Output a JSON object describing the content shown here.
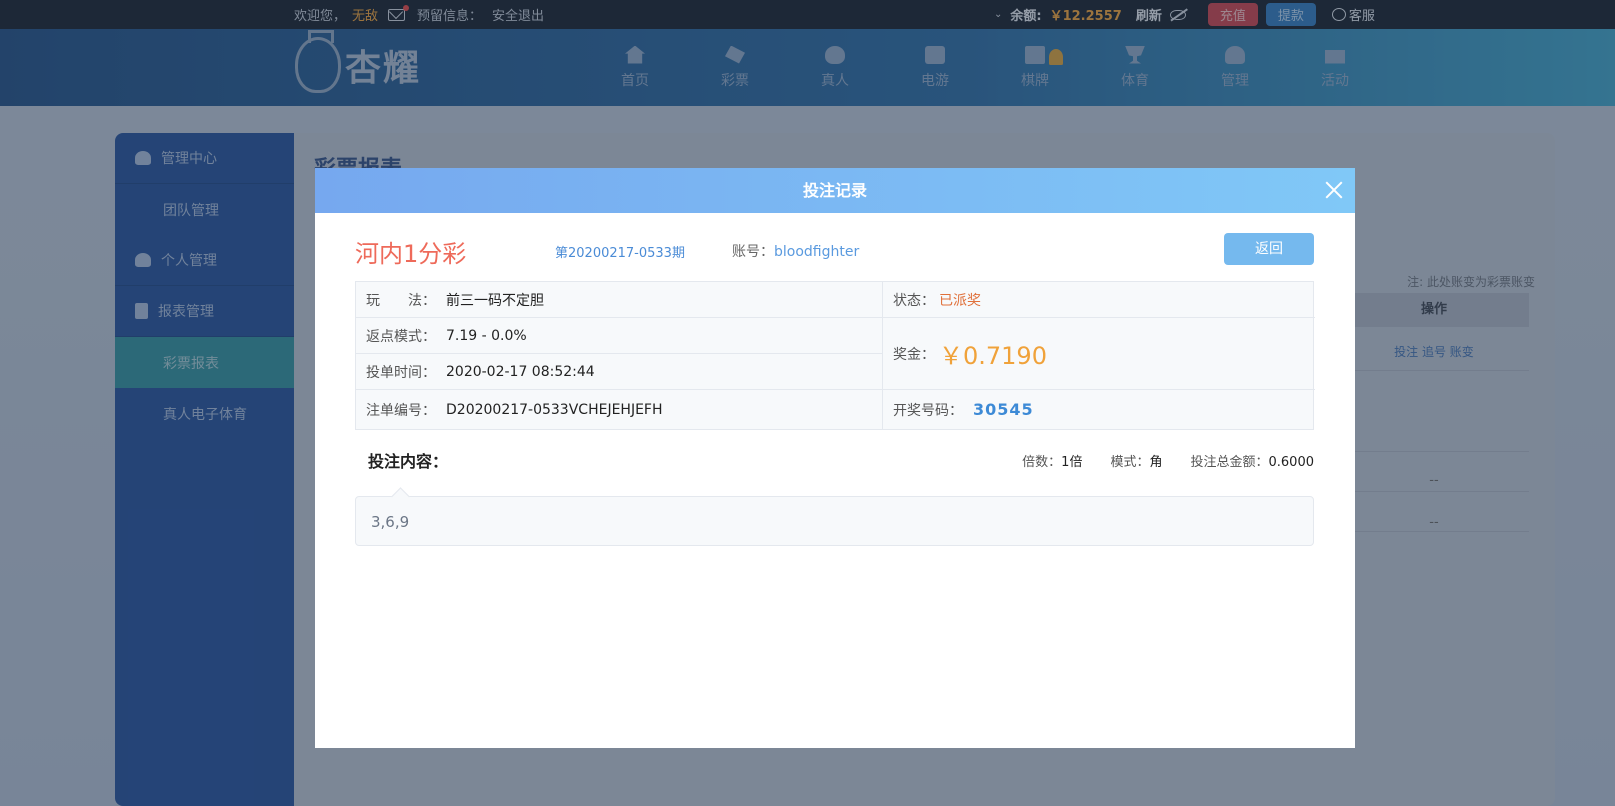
{
  "topbar": {
    "welcome": "欢迎您，",
    "username": "无敌",
    "notice_label": "预留信息：",
    "logout": "安全退出",
    "balance_label": "余额:",
    "balance_value": "￥12.2557",
    "refresh": "刷新",
    "recharge": "充值",
    "withdraw": "提款",
    "service": "客服"
  },
  "logo": {
    "text": "杏耀"
  },
  "nav": {
    "items": [
      {
        "label": "首页",
        "icon": "home-icon"
      },
      {
        "label": "彩票",
        "icon": "lottery-icon"
      },
      {
        "label": "真人",
        "icon": "live-icon"
      },
      {
        "label": "电游",
        "icon": "game-icon"
      },
      {
        "label": "棋牌",
        "icon": "chess-icon"
      },
      {
        "label": "体育",
        "icon": "trophy-icon"
      },
      {
        "label": "管理",
        "icon": "users-icon"
      },
      {
        "label": "活动",
        "icon": "gift-icon"
      }
    ]
  },
  "sidebar": {
    "items": [
      {
        "label": "管理中心"
      },
      {
        "label": "团队管理"
      },
      {
        "label": "个人管理"
      },
      {
        "label": "报表管理"
      },
      {
        "label": "彩票报表"
      },
      {
        "label": "真人电子体育"
      }
    ]
  },
  "background": {
    "page_title": "彩票报表",
    "note": "注: 此处账变为彩票账变",
    "op_header": "操作",
    "op_links": "投注 追号 账变",
    "dash1": "--",
    "dash2": "--"
  },
  "modal": {
    "title": "投注记录",
    "game_name": "河内1分彩",
    "issue": "第20200217-0533期",
    "account_label": "账号：",
    "account_value": "bloodfighter",
    "back_button": "返回",
    "play_label": "玩　　法：",
    "play_value": "前三一码不定胆",
    "rebate_label": "返点模式：",
    "rebate_value": "7.19 - 0.0%",
    "time_label": "投单时间：",
    "time_value": "2020-02-17 08:52:44",
    "order_label": "注单编号：",
    "order_value": "D20200217-0533VCHEJEHJEFH",
    "status_label": "状态：",
    "status_value": "已派奖",
    "prize_label": "奖金：",
    "prize_value": "￥0.7190",
    "draw_label": "开奖号码：",
    "draw_value": "30545",
    "content_label": "投注内容：",
    "multiple_label": "倍数：",
    "multiple_value": "1倍",
    "mode_label": "模式：",
    "mode_value": "角",
    "total_label": "投注总金额：",
    "total_value": "0.6000",
    "bet_content": "3,6,9"
  }
}
